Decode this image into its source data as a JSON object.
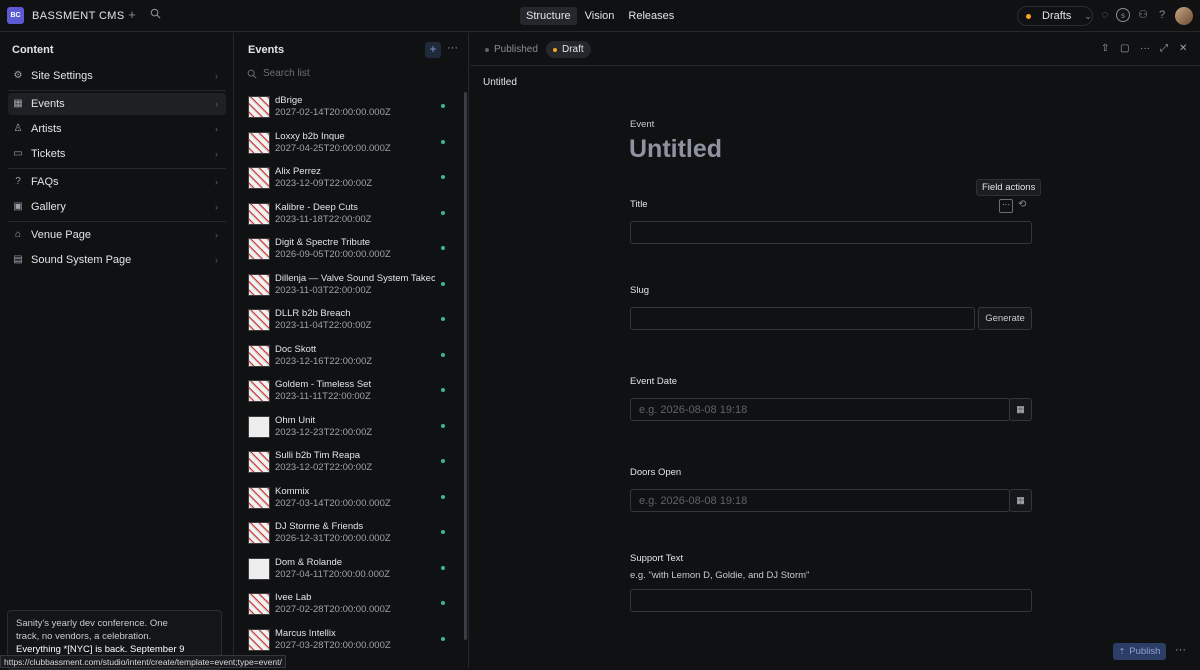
{
  "topbar": {
    "logo_text": "BC",
    "brand": "BASSMENT CMS",
    "nav": [
      "Structure",
      "Vision",
      "Releases"
    ],
    "drafts_label": "Drafts"
  },
  "left": {
    "title": "Content",
    "items": [
      {
        "label": "Site Settings",
        "icon": "settings-icon"
      },
      {
        "label": "Events",
        "icon": "calendar-icon"
      },
      {
        "label": "Artists",
        "icon": "user-icon"
      },
      {
        "label": "Tickets",
        "icon": "ticket-icon"
      },
      {
        "label": "FAQs",
        "icon": "help-icon"
      },
      {
        "label": "Gallery",
        "icon": "image-icon"
      },
      {
        "label": "Venue Page",
        "icon": "home-icon"
      },
      {
        "label": "Sound System Page",
        "icon": "page-icon"
      }
    ],
    "promo_line1": "Sanity's yearly dev conference. One",
    "promo_line2": "track, no vendors, a celebration.",
    "promo_line3": "Everything *[NYC] is back. September 9",
    "status_url": "https://clubbassment.com/studio/intent/create/template=event;type=event/"
  },
  "mid": {
    "title": "Events",
    "search_placeholder": "Search list",
    "items": [
      {
        "title": "dBrige",
        "date": "2027-02-14T20:00:00.000Z"
      },
      {
        "title": "Loxxy b2b Inque",
        "date": "2027-04-25T20:00:00.000Z"
      },
      {
        "title": "Alix Perrez",
        "date": "2023-12-09T22:00:00Z"
      },
      {
        "title": "Kalibre - Deep Cuts",
        "date": "2023-11-18T22:00:00Z"
      },
      {
        "title": "Digit & Spectre Tribute",
        "date": "2026-09-05T20:00:00.000Z"
      },
      {
        "title": "Dillenja — Valve Sound System Takeover",
        "date": "2023-11-03T22:00:00Z"
      },
      {
        "title": "DLLR b2b Breach",
        "date": "2023-11-04T22:00:00Z"
      },
      {
        "title": "Doc Skott",
        "date": "2023-12-16T22:00:00Z"
      },
      {
        "title": "Goldem - Timeless Set",
        "date": "2023-11-11T22:00:00Z"
      },
      {
        "title": "Ohm Unit",
        "date": "2023-12-23T22:00:00Z"
      },
      {
        "title": "Sulli b2b Tim Reapa",
        "date": "2023-12-02T22:00:00Z"
      },
      {
        "title": "Kommix",
        "date": "2027-03-14T20:00:00.000Z"
      },
      {
        "title": "DJ Storme & Friends",
        "date": "2026-12-31T20:00:00.000Z"
      },
      {
        "title": "Dom & Rolande",
        "date": "2027-04-11T20:00:00.000Z"
      },
      {
        "title": "Ivee Lab",
        "date": "2027-02-28T20:00:00.000Z"
      },
      {
        "title": "Marcus Intellix",
        "date": "2027-03-28T20:00:00.000Z"
      }
    ]
  },
  "doc": {
    "published_label": "Published",
    "draft_label": "Draft",
    "breadcrumb": "Untitled",
    "type_label": "Event",
    "heading": "Untitled",
    "tooltip": "Field actions",
    "fields": {
      "title": "Title",
      "slug": "Slug",
      "generate": "Generate",
      "event_date": "Event Date",
      "event_date_placeholder": "e.g. 2026-08-08 19:18",
      "doors_open": "Doors Open",
      "doors_open_placeholder": "e.g. 2026-08-08 19:18",
      "support_text": "Support Text",
      "support_text_hint": "e.g. \"with Lemon D, Goldie, and DJ Storm\""
    },
    "publish_label": "Publish"
  }
}
